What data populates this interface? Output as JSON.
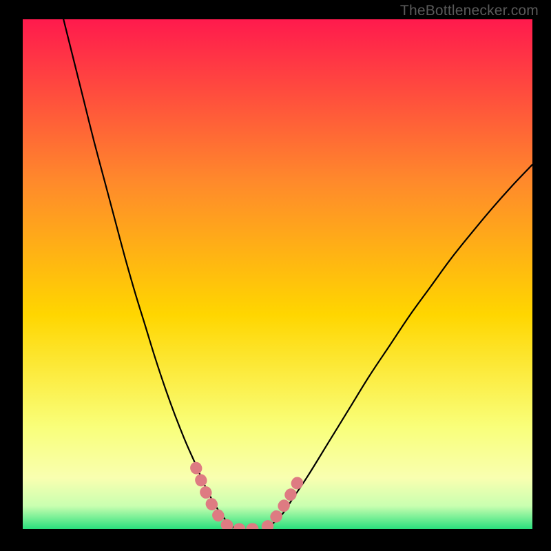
{
  "watermark": "TheBottlenecker.com",
  "chart_data": {
    "type": "line",
    "title": "",
    "xlabel": "",
    "ylabel": "",
    "xlim": [
      0,
      100
    ],
    "ylim": [
      0,
      100
    ],
    "gradient_background": {
      "top_color": "#ff1a4d",
      "mid_upper_color": "#ff8a2b",
      "mid_color": "#ffd600",
      "lower_color": "#f9ff7a",
      "bottom_color": "#2adf7d"
    },
    "series": [
      {
        "name": "left-curve",
        "x": [
          8,
          10,
          12,
          14,
          16,
          18,
          20,
          22,
          24,
          26,
          28,
          30,
          32,
          34,
          35.5,
          37,
          38.5,
          40,
          41,
          42
        ],
        "values": [
          100,
          92,
          84,
          76,
          68.5,
          61,
          53.5,
          46.5,
          40,
          33.5,
          27.5,
          22,
          17,
          12.5,
          9,
          6,
          3.5,
          1.5,
          0.5,
          0
        ]
      },
      {
        "name": "right-curve",
        "x": [
          47.5,
          49,
          51,
          53,
          56,
          60,
          64,
          68,
          72,
          76,
          80,
          84,
          88,
          92,
          96,
          100
        ],
        "values": [
          0,
          1,
          3,
          6,
          10.5,
          17,
          23.5,
          30,
          36,
          42,
          47.5,
          53,
          58,
          62.8,
          67.3,
          71.5
        ]
      },
      {
        "name": "floor-segment",
        "x": [
          42,
          43,
          44,
          45,
          46,
          47,
          47.5
        ],
        "values": [
          0,
          0,
          0,
          0,
          0,
          0,
          0
        ]
      }
    ],
    "highlight_segments": [
      {
        "name": "left-highlight",
        "color": "#de7b82",
        "points_x": [
          34,
          35,
          36,
          37,
          38,
          39,
          40,
          41,
          42,
          43,
          44,
          45,
          46,
          47
        ],
        "points_y": [
          12,
          9.5,
          7,
          5,
          3.2,
          1.8,
          0.8,
          0.3,
          0,
          0,
          0,
          0,
          0,
          0
        ]
      },
      {
        "name": "right-highlight",
        "color": "#de7b82",
        "points_x": [
          48,
          49,
          50,
          51,
          52,
          53,
          54
        ],
        "points_y": [
          0.5,
          1.5,
          2.8,
          4.2,
          5.8,
          7.5,
          9.3
        ]
      }
    ]
  }
}
